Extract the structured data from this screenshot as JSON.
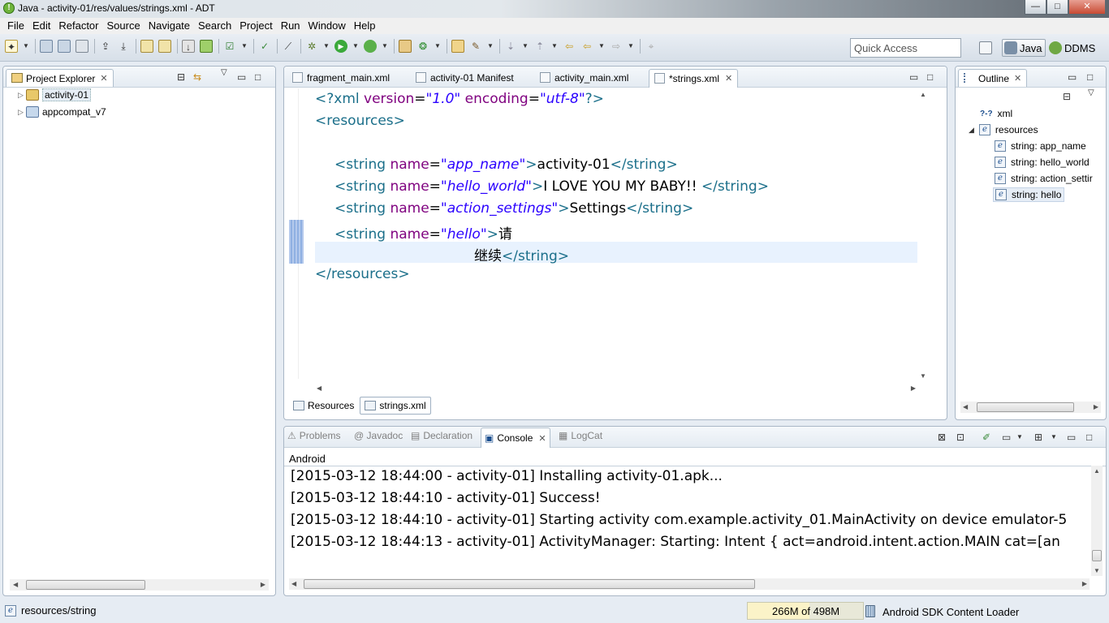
{
  "window": {
    "title": "Java - activity-01/res/values/strings.xml - ADT",
    "buttons": [
      "—",
      "□",
      "✕"
    ]
  },
  "menu": [
    "File",
    "Edit",
    "Refactor",
    "Source",
    "Navigate",
    "Search",
    "Project",
    "Run",
    "Window",
    "Help"
  ],
  "toolbar": {
    "quick_access_placeholder": "Quick Access",
    "perspectives": [
      "Java",
      "DDMS"
    ]
  },
  "project_explorer": {
    "title": "Project Explorer",
    "items": [
      {
        "label": "activity-01",
        "selected": true
      },
      {
        "label": "appcompat_v7",
        "selected": false
      }
    ]
  },
  "editor": {
    "tabs": [
      {
        "label": "fragment_main.xml",
        "active": false
      },
      {
        "label": "activity-01 Manifest",
        "active": false
      },
      {
        "label": "activity_main.xml",
        "active": false
      },
      {
        "label": "*strings.xml",
        "active": true
      }
    ],
    "code": {
      "xml_decl": {
        "open": "<?xml ",
        "version_attr": "version",
        "eq": "=",
        "version_val": "\"1.0\"",
        "encoding_attr": "encoding",
        "encoding_val": "\"utf-8\"",
        "close": "?>"
      },
      "resources_open": "<resources>",
      "strings": [
        {
          "open": "<string ",
          "attr": "name",
          "eq": "=",
          "name_val": "\"app_name\"",
          "gt": ">",
          "text": "activity-01",
          "close": "</string>"
        },
        {
          "open": "<string ",
          "attr": "name",
          "eq": "=",
          "name_val": "\"hello_world\"",
          "gt": ">",
          "text": "I LOVE YOU MY BABY!! ",
          "close": "</string>"
        },
        {
          "open": "<string ",
          "attr": "name",
          "eq": "=",
          "name_val": "\"action_settings\"",
          "gt": ">",
          "text": "Settings",
          "close": "</string>"
        },
        {
          "open": "<string ",
          "attr": "name",
          "eq": "=",
          "name_val": "\"hello\"",
          "gt": ">",
          "text": "请",
          "close": ""
        }
      ],
      "continuation": {
        "text": "继续",
        "close": "</string>"
      },
      "resources_close": "</resources>"
    },
    "bottom_tabs": [
      {
        "label": "Resources",
        "active": false
      },
      {
        "label": "strings.xml",
        "active": true
      }
    ]
  },
  "outline": {
    "title": "Outline",
    "items": [
      {
        "label": "xml",
        "icon": "?-?"
      },
      {
        "label": "resources",
        "icon": "e"
      },
      {
        "label": "string: app_name",
        "icon": "e"
      },
      {
        "label": "string: hello_world",
        "icon": "e"
      },
      {
        "label": "string: action_settir",
        "icon": "e"
      },
      {
        "label": "string: hello",
        "icon": "e",
        "selected": true
      }
    ]
  },
  "console": {
    "tabs": [
      {
        "label": "Problems",
        "active": false
      },
      {
        "label": "@ Javadoc",
        "active": false
      },
      {
        "label": "Declaration",
        "active": false
      },
      {
        "label": "Console",
        "active": true
      },
      {
        "label": "LogCat",
        "active": false
      }
    ],
    "label": "Android",
    "lines": [
      "[2015-03-12 18:44:00 - activity-01] Installing activity-01.apk...",
      "[2015-03-12 18:44:10 - activity-01] Success!",
      "[2015-03-12 18:44:10 - activity-01] Starting activity com.example.activity_01.MainActivity on device emulator-5",
      "[2015-03-12 18:44:13 - activity-01] ActivityManager: Starting: Intent { act=android.intent.action.MAIN cat=[an"
    ]
  },
  "statusbar": {
    "selection": "resources/string",
    "heap_label": "266M of 498M",
    "heap_used_fraction": 0.534,
    "loader": "Android SDK Content Loader"
  }
}
